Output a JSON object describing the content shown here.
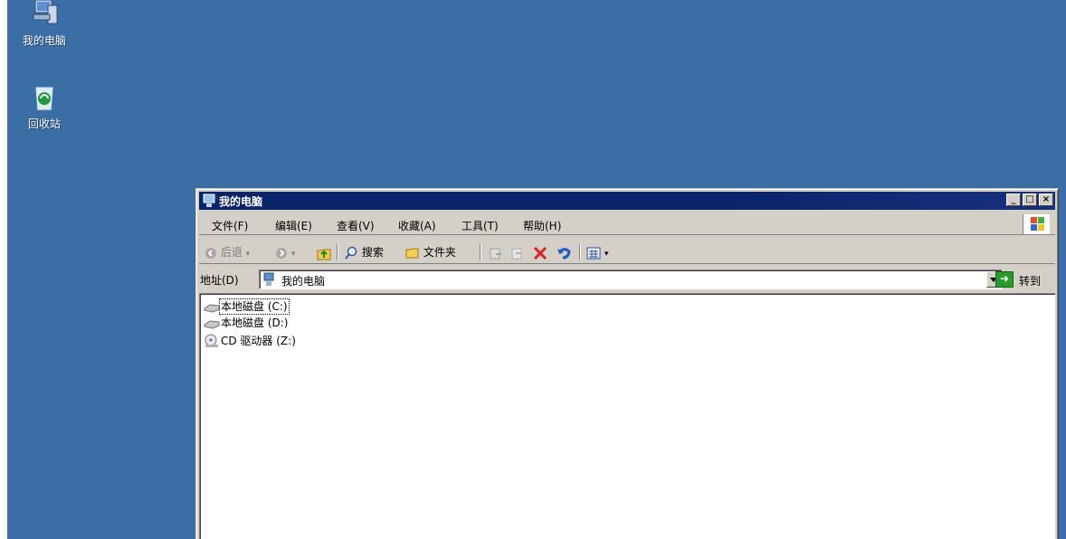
{
  "desktop": {
    "icons": [
      {
        "label": "我的电脑",
        "icon": "my-computer-icon"
      },
      {
        "label": "回收站",
        "icon": "recycle-bin-icon"
      }
    ]
  },
  "window": {
    "title": "我的电脑",
    "menu": [
      "文件(F)",
      "编辑(E)",
      "查看(V)",
      "收藏(A)",
      "工具(T)",
      "帮助(H)"
    ],
    "toolbar": {
      "back": "后退",
      "search": "搜索",
      "folders": "文件夹"
    },
    "address": {
      "label": "地址(D)",
      "value": "我的电脑",
      "go": "转到"
    },
    "drives": [
      {
        "label": "本地磁盘 (C:)",
        "icon": "hard-disk-icon"
      },
      {
        "label": "本地磁盘 (D:)",
        "icon": "hard-disk-icon"
      },
      {
        "label": "CD 驱动器 (Z:)",
        "icon": "cd-drive-icon"
      }
    ]
  },
  "colors": {
    "desktop": "#3a6ea5",
    "titlebar": "#0a246a",
    "chrome": "#d4d0c8"
  }
}
